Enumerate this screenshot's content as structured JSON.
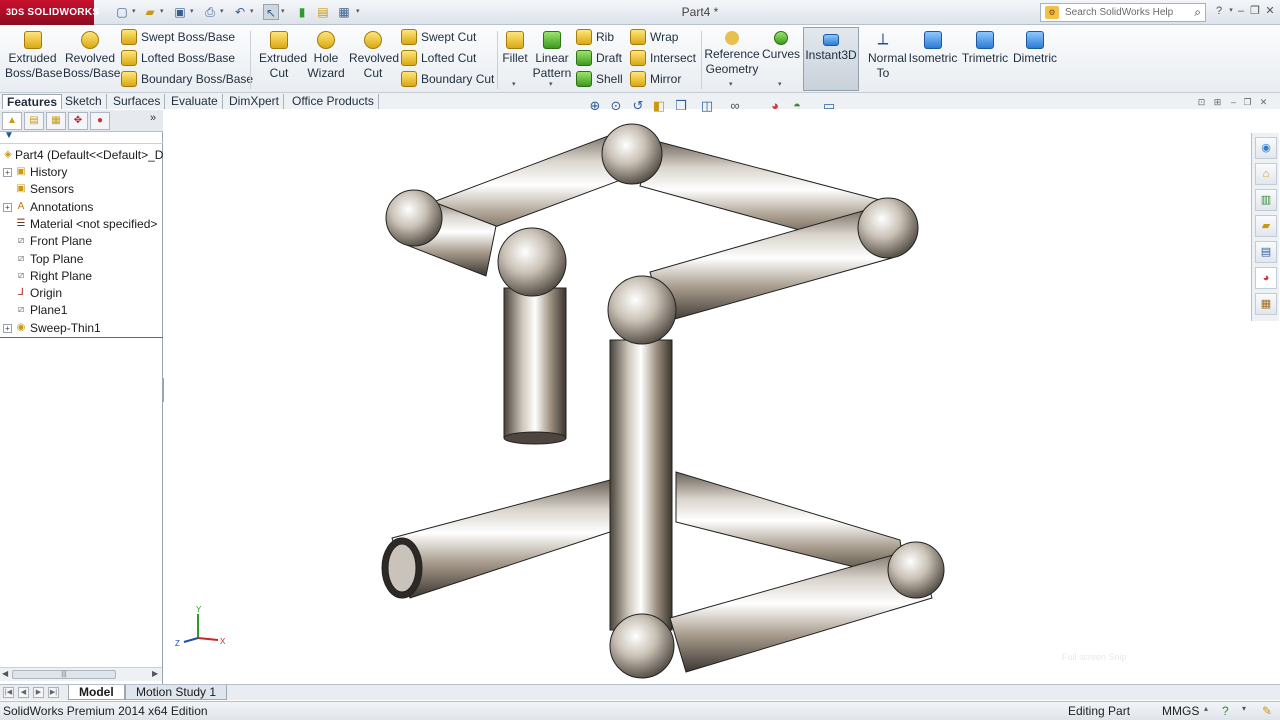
{
  "app": {
    "logo_text": "SOLIDWORKS",
    "document_title": "Part4 *",
    "search_placeholder": "Search SolidWorks Help",
    "help_icon": "?"
  },
  "ribbon": {
    "features": {
      "extruded_boss": "Extruded Boss/Base",
      "revolved_boss": "Revolved Boss/Base",
      "swept_boss": "Swept Boss/Base",
      "lofted_boss": "Lofted Boss/Base",
      "boundary_boss": "Boundary Boss/Base",
      "extruded_cut": "Extruded Cut",
      "hole_wizard": "Hole Wizard",
      "revolved_cut": "Revolved Cut",
      "swept_cut": "Swept Cut",
      "lofted_cut": "Lofted Cut",
      "boundary_cut": "Boundary Cut",
      "fillet": "Fillet",
      "linear_pattern": "Linear Pattern",
      "rib": "Rib",
      "draft": "Draft",
      "shell": "Shell",
      "wrap": "Wrap",
      "intersect": "Intersect",
      "mirror": "Mirror",
      "reference_geometry": "Reference Geometry",
      "curves": "Curves",
      "instant3d": "Instant3D",
      "normal_to": "Normal To",
      "isometric": "Isometric",
      "trimetric": "Trimetric",
      "dimetric": "Dimetric"
    }
  },
  "tabs": [
    "Features",
    "Sketch",
    "Surfaces",
    "Evaluate",
    "DimXpert",
    "Office Products"
  ],
  "tree": {
    "root": "Part4  (Default<<Default>_D",
    "items": [
      {
        "label": "History",
        "icon": "folder-icon",
        "expandable": true
      },
      {
        "label": "Sensors",
        "icon": "folder-icon",
        "expandable": false
      },
      {
        "label": "Annotations",
        "icon": "annotations-icon",
        "expandable": true
      },
      {
        "label": "Material <not specified>",
        "icon": "material-icon",
        "expandable": false
      },
      {
        "label": "Front Plane",
        "icon": "plane-icon",
        "expandable": false
      },
      {
        "label": "Top Plane",
        "icon": "plane-icon",
        "expandable": false
      },
      {
        "label": "Right Plane",
        "icon": "plane-icon",
        "expandable": false
      },
      {
        "label": "Origin",
        "icon": "origin-icon",
        "expandable": false
      },
      {
        "label": "Plane1",
        "icon": "plane-icon",
        "expandable": false
      },
      {
        "label": "Sweep-Thin1",
        "icon": "sweep-icon",
        "expandable": true
      }
    ]
  },
  "triad": {
    "x": "X",
    "y": "Y",
    "z": "Z"
  },
  "viewport": {
    "overlay_text": "Full screen Snip"
  },
  "bottom_tabs": {
    "model": "Model",
    "motion": "Motion Study 1"
  },
  "status": {
    "edition": "SolidWorks Premium 2014 x64 Edition",
    "mode": "Editing Part",
    "units": "MMGS"
  },
  "colors": {
    "brand": "#c8102e",
    "selection_blue": "#3a6fb5"
  }
}
